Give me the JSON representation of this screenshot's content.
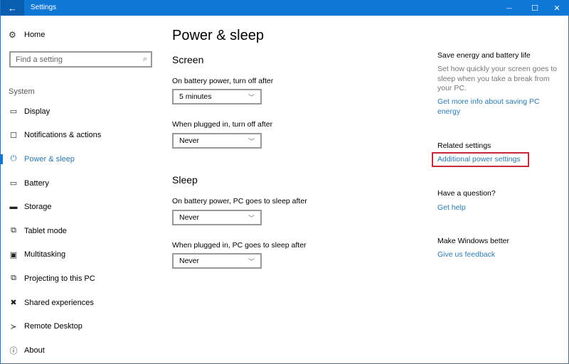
{
  "titlebar": {
    "title": "Settings",
    "back_icon": "←",
    "minimize_icon": "—",
    "maximize_icon": "☐",
    "close_icon": "✕"
  },
  "sidebar": {
    "home_label": "Home",
    "home_icon": "⚙",
    "search_placeholder": "Find a setting",
    "search_icon": "⌕",
    "section_label": "System",
    "items": [
      {
        "label": "Display",
        "icon": "▭"
      },
      {
        "label": "Notifications & actions",
        "icon": "☐"
      },
      {
        "label": "Power & sleep",
        "icon": "⏻",
        "active": true
      },
      {
        "label": "Battery",
        "icon": "▭"
      },
      {
        "label": "Storage",
        "icon": "▬"
      },
      {
        "label": "Tablet mode",
        "icon": "⧉"
      },
      {
        "label": "Multitasking",
        "icon": "▣"
      },
      {
        "label": "Projecting to this PC",
        "icon": "⧉"
      },
      {
        "label": "Shared experiences",
        "icon": "✖"
      },
      {
        "label": "Remote Desktop",
        "icon": "≻"
      },
      {
        "label": "About",
        "icon": "ⓘ"
      }
    ]
  },
  "main": {
    "title": "Power & sleep",
    "screen": {
      "heading": "Screen",
      "battery_label": "On battery power, turn off after",
      "battery_value": "5 minutes",
      "plugged_label": "When plugged in, turn off after",
      "plugged_value": "Never"
    },
    "sleep": {
      "heading": "Sleep",
      "battery_label": "On battery power, PC goes to sleep after",
      "battery_value": "Never",
      "plugged_label": "When plugged in, PC goes to sleep after",
      "plugged_value": "Never"
    },
    "chevron": "﹀"
  },
  "aside": {
    "save_heading": "Save energy and battery life",
    "save_text": "Set how quickly your screen goes to sleep when you take a break from your PC.",
    "save_link": "Get more info about saving PC energy",
    "related_heading": "Related settings",
    "related_link": "Additional power settings",
    "question_heading": "Have a question?",
    "question_link": "Get help",
    "better_heading": "Make Windows better",
    "better_link": "Give us feedback",
    "highlight_color": "#c8283a"
  }
}
